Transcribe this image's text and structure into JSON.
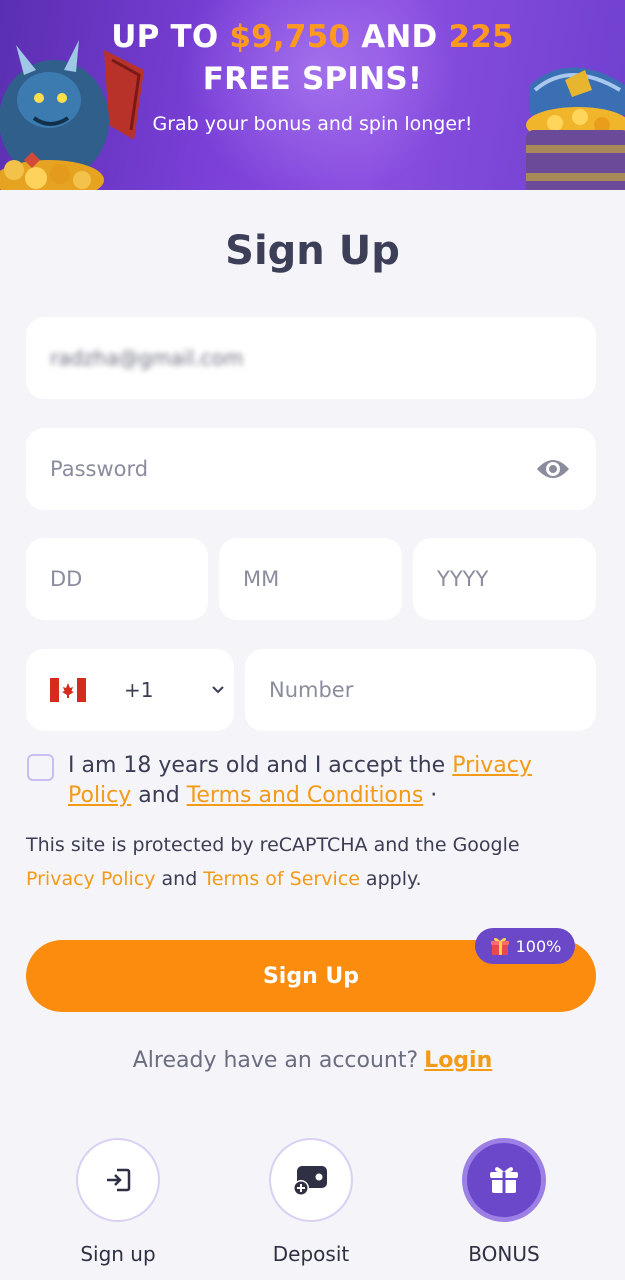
{
  "banner": {
    "title_prefix": "UP TO ",
    "amount": "$9,750",
    "title_mid": " AND ",
    "spins_count": "225",
    "title_line2": "FREE SPINS!",
    "subtitle": "Grab your bonus and spin longer!"
  },
  "form": {
    "title": "Sign Up",
    "email_value": "radzha@gmail.com",
    "password_placeholder": "Password",
    "dob": {
      "day_placeholder": "DD",
      "month_placeholder": "MM",
      "year_placeholder": "YYYY"
    },
    "phone": {
      "country_code": "+1",
      "number_placeholder": "Number"
    },
    "consent": {
      "text_before": "I am 18 years old and I accept the ",
      "privacy_link": "Privacy Policy",
      "text_mid": " and ",
      "terms_link": "Terms and Conditions",
      "text_after": " ·"
    },
    "recaptcha": {
      "text_before": "This site is protected by reCAPTCHA and the Google",
      "privacy_link": "Privacy Policy",
      "text_mid": " and ",
      "terms_link": "Terms of Service",
      "text_after": " apply."
    },
    "submit_label": "Sign Up",
    "bonus_badge": "100%",
    "already_text": "Already have an account?",
    "login_link": "Login"
  },
  "bottom_nav": {
    "items": [
      {
        "label": "Sign up",
        "icon": "sign-in-icon"
      },
      {
        "label": "Deposit",
        "icon": "deposit-wallet-icon"
      },
      {
        "label": "BONUS",
        "icon": "gift-icon"
      }
    ]
  },
  "colors": {
    "accent": "#fb8c0e",
    "brand_purple": "#6b47c9",
    "link": "#f39a17"
  }
}
